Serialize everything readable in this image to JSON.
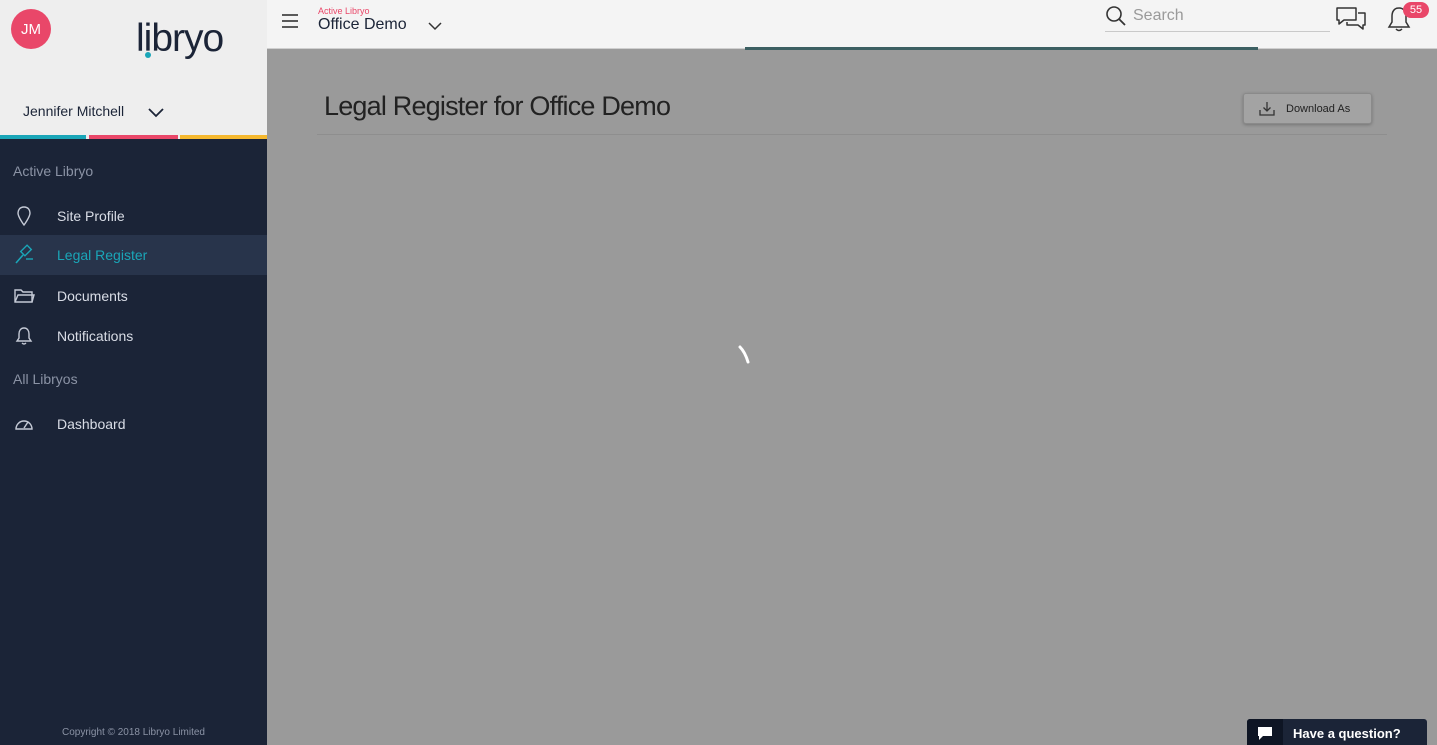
{
  "user": {
    "initials": "JM",
    "name": "Jennifer Mitchell"
  },
  "brand": {
    "logo_text": "libryo",
    "stripe_colors": [
      "#1aa6b8",
      "#e94769",
      "#f5b82e"
    ],
    "accent": "#1aa6b8",
    "alert": "#e94769"
  },
  "sidebar": {
    "heading_active": "Active Libryo",
    "heading_all": "All Libryos",
    "items": [
      {
        "label": "Site Profile",
        "icon": "map-pin-icon",
        "active": false
      },
      {
        "label": "Legal Register",
        "icon": "gavel-icon",
        "active": true
      },
      {
        "label": "Documents",
        "icon": "folder-icon",
        "active": false
      },
      {
        "label": "Notifications",
        "icon": "bell-icon",
        "active": false
      }
    ],
    "dashboard": {
      "label": "Dashboard",
      "icon": "dashboard-gauge-icon"
    },
    "copyright": "Copyright © 2018 Libryo Limited"
  },
  "topbar": {
    "crumb_small": "Active Libryo",
    "crumb_title": "Office Demo",
    "search_placeholder": "Search",
    "notification_count": "55"
  },
  "main": {
    "title": "Legal Register for Office Demo",
    "download_label": "Download As",
    "loading": true
  },
  "help": {
    "label": "Have a question?"
  }
}
